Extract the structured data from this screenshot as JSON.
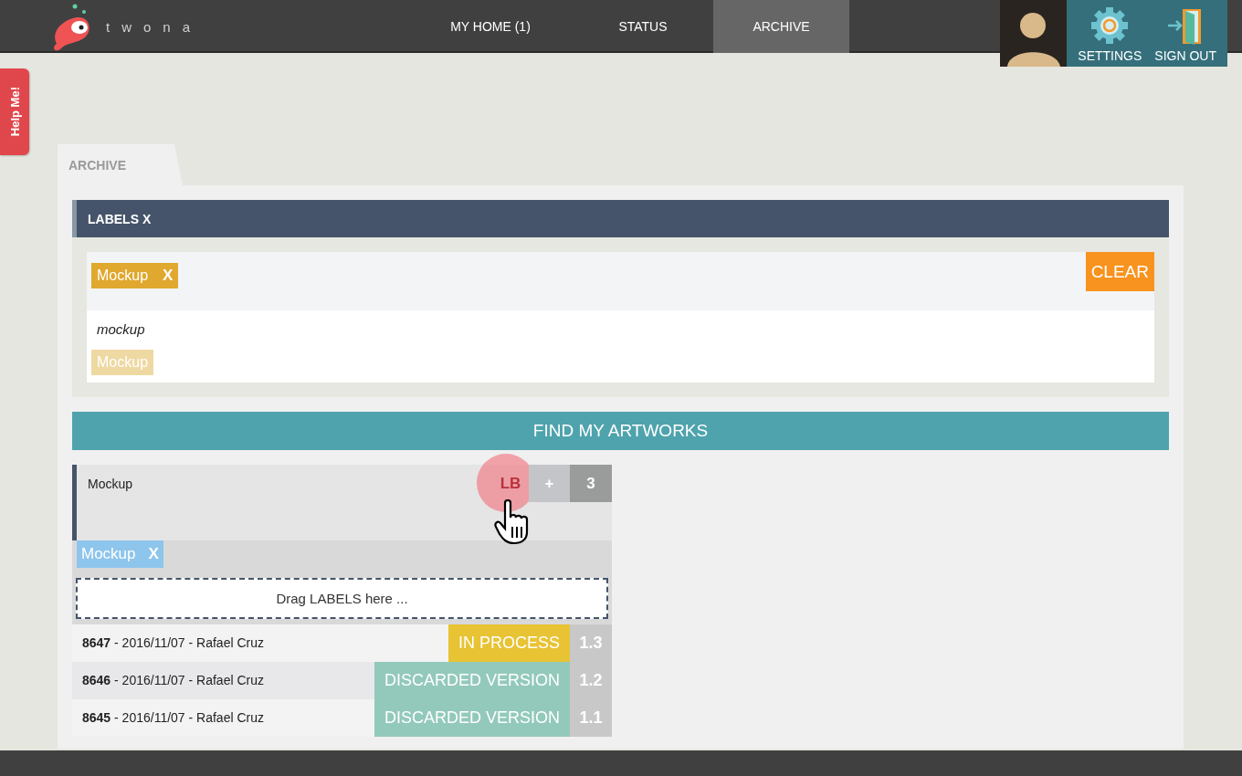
{
  "header": {
    "logo_text": "twona",
    "nav": [
      {
        "label": "MY HOME (1)",
        "selected": false
      },
      {
        "label": "STATUS",
        "selected": false
      },
      {
        "label": "ARCHIVE",
        "selected": true
      }
    ],
    "actions": [
      {
        "label": "SETTINGS",
        "kind": "settings"
      },
      {
        "label": "SIGN OUT",
        "kind": "signout"
      }
    ]
  },
  "help_tab": "Help Me!",
  "page_tab": "ARCHIVE",
  "labels_panel": {
    "title": "LABELS X",
    "selected_labels": [
      {
        "text": "Mockup",
        "remove": "X"
      }
    ],
    "clear_button": "CLEAR",
    "query": "mockup",
    "suggestions": [
      "Mockup"
    ]
  },
  "find_button": "FIND MY ARTWORKS",
  "artwork": {
    "title": "Mockup",
    "label_button": "LB",
    "add_button": "+",
    "count": "3",
    "labels": [
      {
        "text": "Mockup",
        "remove": "X"
      }
    ],
    "drop_zone": "Drag LABELS here ...",
    "versions": [
      {
        "info": "**8647** - 2016/11/07 - Rafael Cruz",
        "status": "IN PROCESS",
        "color": "#e8c334",
        "version": "1.3"
      },
      {
        "info": "**8646** - 2016/11/07 - Rafael Cruz",
        "status": "DISCARDED VERSION",
        "color": "#93c9bb",
        "version": "1.2"
      },
      {
        "info": "**8645** - 2016/11/07 - Rafael Cruz",
        "status": "DISCARDED VERSION",
        "color": "#93c9bb",
        "version": "1.1"
      }
    ]
  }
}
